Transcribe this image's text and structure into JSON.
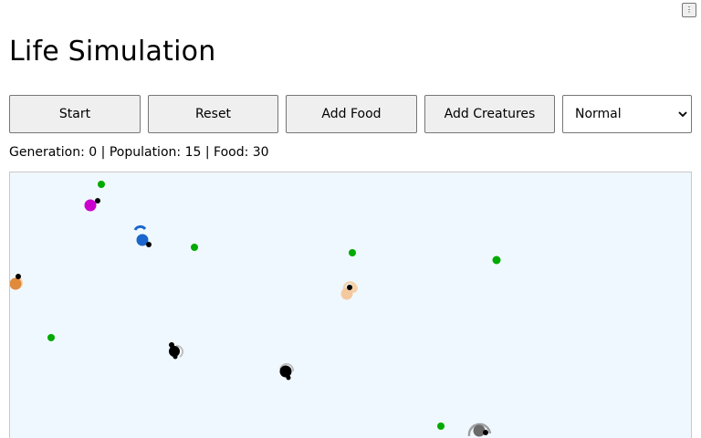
{
  "corner_button": {
    "glyph": "⋮"
  },
  "title": "Life Simulation",
  "controls": {
    "start_label": "Start",
    "reset_label": "Reset",
    "add_food_label": "Add Food",
    "add_creatures_label": "Add Creatures",
    "speed_select": {
      "value": "Normal"
    }
  },
  "status": {
    "generation_label": "Generation:",
    "generation": "0",
    "population_label": "Population:",
    "population": "15",
    "food_label": "Food:",
    "food": "30",
    "separator": "|"
  },
  "colors": {
    "canvas_bg": "#f0f8ff",
    "food": "#00aa00",
    "creature_black": "#000000"
  }
}
